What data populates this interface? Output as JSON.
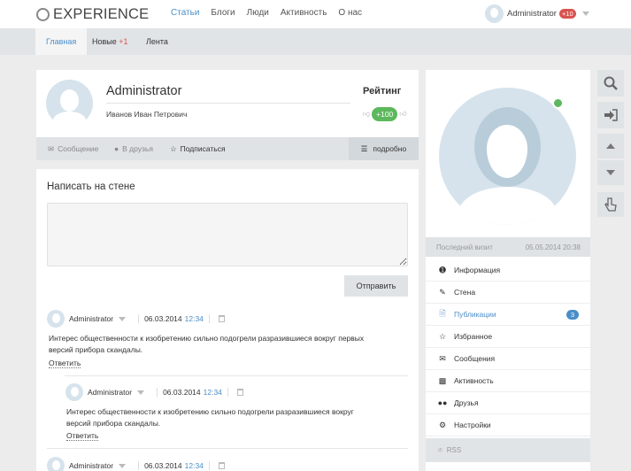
{
  "header": {
    "logo_text": "EXPERIENCE",
    "nav": [
      {
        "label": "Статьи",
        "active": true
      },
      {
        "label": "Блоги",
        "active": false
      },
      {
        "label": "Люди",
        "active": false
      },
      {
        "label": "Активность",
        "active": false
      },
      {
        "label": "О нас",
        "active": false
      }
    ],
    "user": {
      "name": "Administrator",
      "badge": "+10"
    }
  },
  "subnav": {
    "tabs": [
      {
        "label": "Главная",
        "active": true
      },
      {
        "label": "Новые",
        "count": "+1"
      },
      {
        "label": "Лента"
      }
    ]
  },
  "profile": {
    "name": "Administrator",
    "full_name": "Иванов Иван Петрович",
    "rating_label": "Рейтинг",
    "rating_value": "+100",
    "actions": {
      "message": "Сообщение",
      "friend": "В друзья",
      "subscribe": "Подписаться",
      "more": "подробно"
    }
  },
  "wall": {
    "title": "Написать на стене",
    "textarea_value": "",
    "submit_label": "Отправить",
    "posts": [
      {
        "author": "Administrator",
        "date": "06.03.2014",
        "time": "12:34",
        "text_lines": [
          "Интерес общественности к изобретению сильно подогрели разразившиеся вокруг первых",
          "версий прибора скандалы."
        ],
        "reply_label": "Ответить"
      },
      {
        "author": "Administrator",
        "date": "06.03.2014",
        "time": "12:34",
        "text_lines": [
          "Интерес общественности к изобретению сильно подогрели разразившиеся вокруг",
          "версий прибора скандалы."
        ],
        "reply_label": "Ответить"
      },
      {
        "author": "Administrator",
        "date": "06.03.2014",
        "time": "12:34"
      }
    ]
  },
  "sidebar": {
    "last_visit_label": "Последний визит",
    "last_visit_value": "05.05.2014 20:38",
    "menu": [
      {
        "label": "Информация",
        "icon": "info-icon"
      },
      {
        "label": "Стена",
        "icon": "edit-icon"
      },
      {
        "label": "Публикации",
        "icon": "file-icon",
        "active": true,
        "badge": "3"
      },
      {
        "label": "Избранное",
        "icon": "star-icon"
      },
      {
        "label": "Сообщения",
        "icon": "envelope-icon"
      },
      {
        "label": "Активность",
        "icon": "chart-icon"
      },
      {
        "label": "Друзья",
        "icon": "users-icon"
      },
      {
        "label": "Настройки",
        "icon": "gears-icon"
      }
    ],
    "rss_label": "RSS"
  },
  "tools": [
    "search-icon",
    "login-icon",
    "arrow-up-icon",
    "arrow-down-icon",
    "hand-pointer-icon"
  ],
  "colors": {
    "accent": "#4a8ec8",
    "online": "#5cb85c",
    "badge_red": "#d9534f"
  }
}
